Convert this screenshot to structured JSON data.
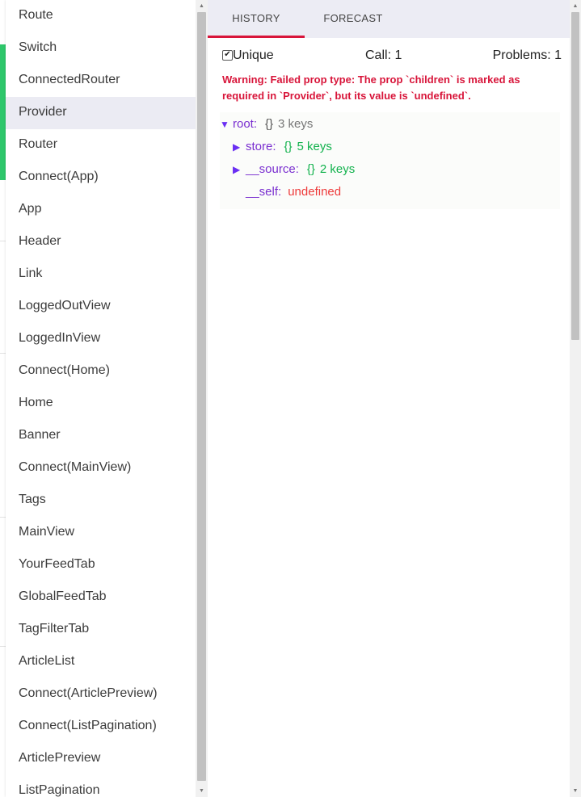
{
  "sidebar": {
    "items": [
      {
        "label": "Route",
        "selected": false
      },
      {
        "label": "Switch",
        "selected": false
      },
      {
        "label": "ConnectedRouter",
        "selected": false
      },
      {
        "label": "Provider",
        "selected": true
      },
      {
        "label": "Router",
        "selected": false
      },
      {
        "label": "Connect(App)",
        "selected": false
      },
      {
        "label": "App",
        "selected": false
      },
      {
        "label": "Header",
        "selected": false
      },
      {
        "label": "Link",
        "selected": false
      },
      {
        "label": "LoggedOutView",
        "selected": false
      },
      {
        "label": "LoggedInView",
        "selected": false
      },
      {
        "label": "Connect(Home)",
        "selected": false
      },
      {
        "label": "Home",
        "selected": false
      },
      {
        "label": "Banner",
        "selected": false
      },
      {
        "label": "Connect(MainView)",
        "selected": false
      },
      {
        "label": "Tags",
        "selected": false
      },
      {
        "label": "MainView",
        "selected": false
      },
      {
        "label": "YourFeedTab",
        "selected": false
      },
      {
        "label": "GlobalFeedTab",
        "selected": false
      },
      {
        "label": "TagFilterTab",
        "selected": false
      },
      {
        "label": "ArticleList",
        "selected": false
      },
      {
        "label": "Connect(ArticlePreview)",
        "selected": false
      },
      {
        "label": "Connect(ListPagination)",
        "selected": false
      },
      {
        "label": "ArticlePreview",
        "selected": false
      },
      {
        "label": "ListPagination",
        "selected": false
      }
    ]
  },
  "tabs": {
    "history": "HISTORY",
    "forecast": "FORECAST",
    "active": "history"
  },
  "controls": {
    "unique_label": "Unique",
    "unique_checked": true,
    "call": "Call: 1",
    "problems": "Problems: 1"
  },
  "warning": "Warning: Failed prop type: The prop `children` is marked as required in `Provider`, but its value is `undefined`.",
  "tree": {
    "root": {
      "key": "root:",
      "brace": "{}",
      "meta": "3 keys",
      "icon": "caret-down-icon"
    },
    "store": {
      "key": "store:",
      "brace": "{}",
      "meta": "5 keys",
      "icon": "caret-right-icon"
    },
    "source": {
      "key": "__source:",
      "brace": "{}",
      "meta": "2 keys",
      "icon": "caret-right-icon"
    },
    "self": {
      "key": "__self:",
      "value": "undefined"
    }
  },
  "colors": {
    "accent": "#d8153a",
    "key": "#7a2fd0",
    "green": "#12b24d",
    "undefined": "#ee3b3b",
    "selected_bg": "#ebebf3",
    "tabbar_bg": "#ececf4"
  }
}
